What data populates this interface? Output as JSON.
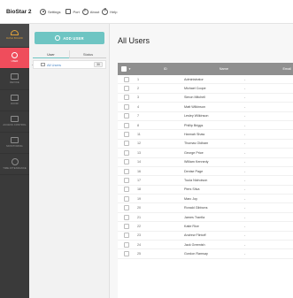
{
  "app": {
    "title": "BioStar 2",
    "top_nav": [
      {
        "label": "Settings",
        "icon": "gear-icon"
      },
      {
        "label": "Port",
        "icon": "port-icon"
      },
      {
        "label": "About",
        "icon": "info-icon"
      },
      {
        "label": "Help",
        "icon": "help-icon"
      }
    ]
  },
  "sidebar": {
    "items": [
      {
        "label": "DASH BOARD",
        "icon": "dashboard-icon"
      },
      {
        "label": "USER",
        "icon": "user-icon"
      },
      {
        "label": "DEVICE",
        "icon": "device-icon"
      },
      {
        "label": "DOOR",
        "icon": "door-icon"
      },
      {
        "label": "ACCESS CONTROL",
        "icon": "access-control-icon"
      },
      {
        "label": "MONITORING",
        "icon": "monitoring-icon"
      },
      {
        "label": "TIME ATTENDANCE",
        "icon": "time-attendance-icon"
      }
    ],
    "active_index": 1
  },
  "user_panel": {
    "add_button": "ADD USER",
    "tabs": [
      "User",
      "Status"
    ],
    "group": {
      "name": "All Users",
      "count": "30"
    }
  },
  "main": {
    "title": "All Users",
    "columns": {
      "id": "ID",
      "name": "Name",
      "email": "Email"
    },
    "rows": [
      {
        "id": "1",
        "name": "Administrator",
        "email": "-"
      },
      {
        "id": "2",
        "name": "Michael Coope",
        "email": "-"
      },
      {
        "id": "3",
        "name": "Simon Mitchell",
        "email": "-"
      },
      {
        "id": "4",
        "name": "Matt Wilkinson",
        "email": "-"
      },
      {
        "id": "7",
        "name": "Lesley Wilkinson",
        "email": "-"
      },
      {
        "id": "8",
        "name": "Phillip Briggs",
        "email": "-"
      },
      {
        "id": "11",
        "name": "Hannah Shaw",
        "email": "-"
      },
      {
        "id": "12",
        "name": "Thomas Oldham",
        "email": "-"
      },
      {
        "id": "13",
        "name": "George Price",
        "email": "-"
      },
      {
        "id": "14",
        "name": "William Kennedy",
        "email": "-"
      },
      {
        "id": "16",
        "name": "Denise Page",
        "email": "-"
      },
      {
        "id": "17",
        "name": "Tuula Nicholson",
        "email": "-"
      },
      {
        "id": "18",
        "name": "Piers Silva",
        "email": "-"
      },
      {
        "id": "19",
        "name": "Marc Joy",
        "email": "-"
      },
      {
        "id": "20",
        "name": "Ronald Gibbons",
        "email": "-"
      },
      {
        "id": "21",
        "name": "James Tranfia",
        "email": "-"
      },
      {
        "id": "22",
        "name": "Katie Rice",
        "email": "-"
      },
      {
        "id": "23",
        "name": "Andrew Flintoff",
        "email": "-"
      },
      {
        "id": "24",
        "name": "Jack Greenish",
        "email": "-"
      },
      {
        "id": "25",
        "name": "Gordon Ramsay",
        "email": "-"
      }
    ]
  },
  "colors": {
    "accent": "#6ec5c3",
    "active_nav": "#ef4d5c",
    "sidebar": "#3a3a3a",
    "grid_header": "#8f8f8f"
  }
}
